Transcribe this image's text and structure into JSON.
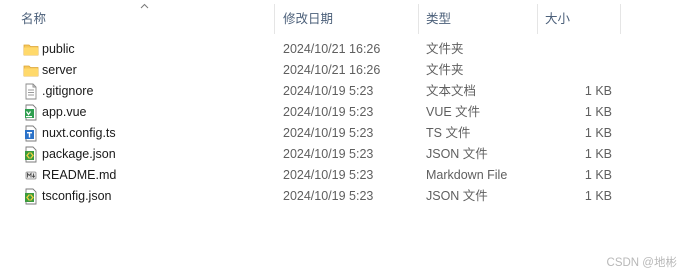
{
  "columns": {
    "name": "名称",
    "date": "修改日期",
    "type": "类型",
    "size": "大小"
  },
  "files": [
    {
      "name": "public",
      "date": "2024/10/21 16:26",
      "type": "文件夹",
      "size": "",
      "icon": "folder-icon"
    },
    {
      "name": "server",
      "date": "2024/10/21 16:26",
      "type": "文件夹",
      "size": "",
      "icon": "folder-icon"
    },
    {
      "name": ".gitignore",
      "date": "2024/10/19 5:23",
      "type": "文本文档",
      "size": "1 KB",
      "icon": "text-file-icon"
    },
    {
      "name": "app.vue",
      "date": "2024/10/19 5:23",
      "type": "VUE 文件",
      "size": "1 KB",
      "icon": "vue-file-icon"
    },
    {
      "name": "nuxt.config.ts",
      "date": "2024/10/19 5:23",
      "type": "TS 文件",
      "size": "1 KB",
      "icon": "ts-file-icon"
    },
    {
      "name": "package.json",
      "date": "2024/10/19 5:23",
      "type": "JSON 文件",
      "size": "1 KB",
      "icon": "json-file-icon"
    },
    {
      "name": "README.md",
      "date": "2024/10/19 5:23",
      "type": "Markdown File",
      "size": "1 KB",
      "icon": "markdown-file-icon"
    },
    {
      "name": "tsconfig.json",
      "date": "2024/10/19 5:23",
      "type": "JSON 文件",
      "size": "1 KB",
      "icon": "json-file-icon"
    }
  ],
  "watermark": "CSDN @地彬"
}
